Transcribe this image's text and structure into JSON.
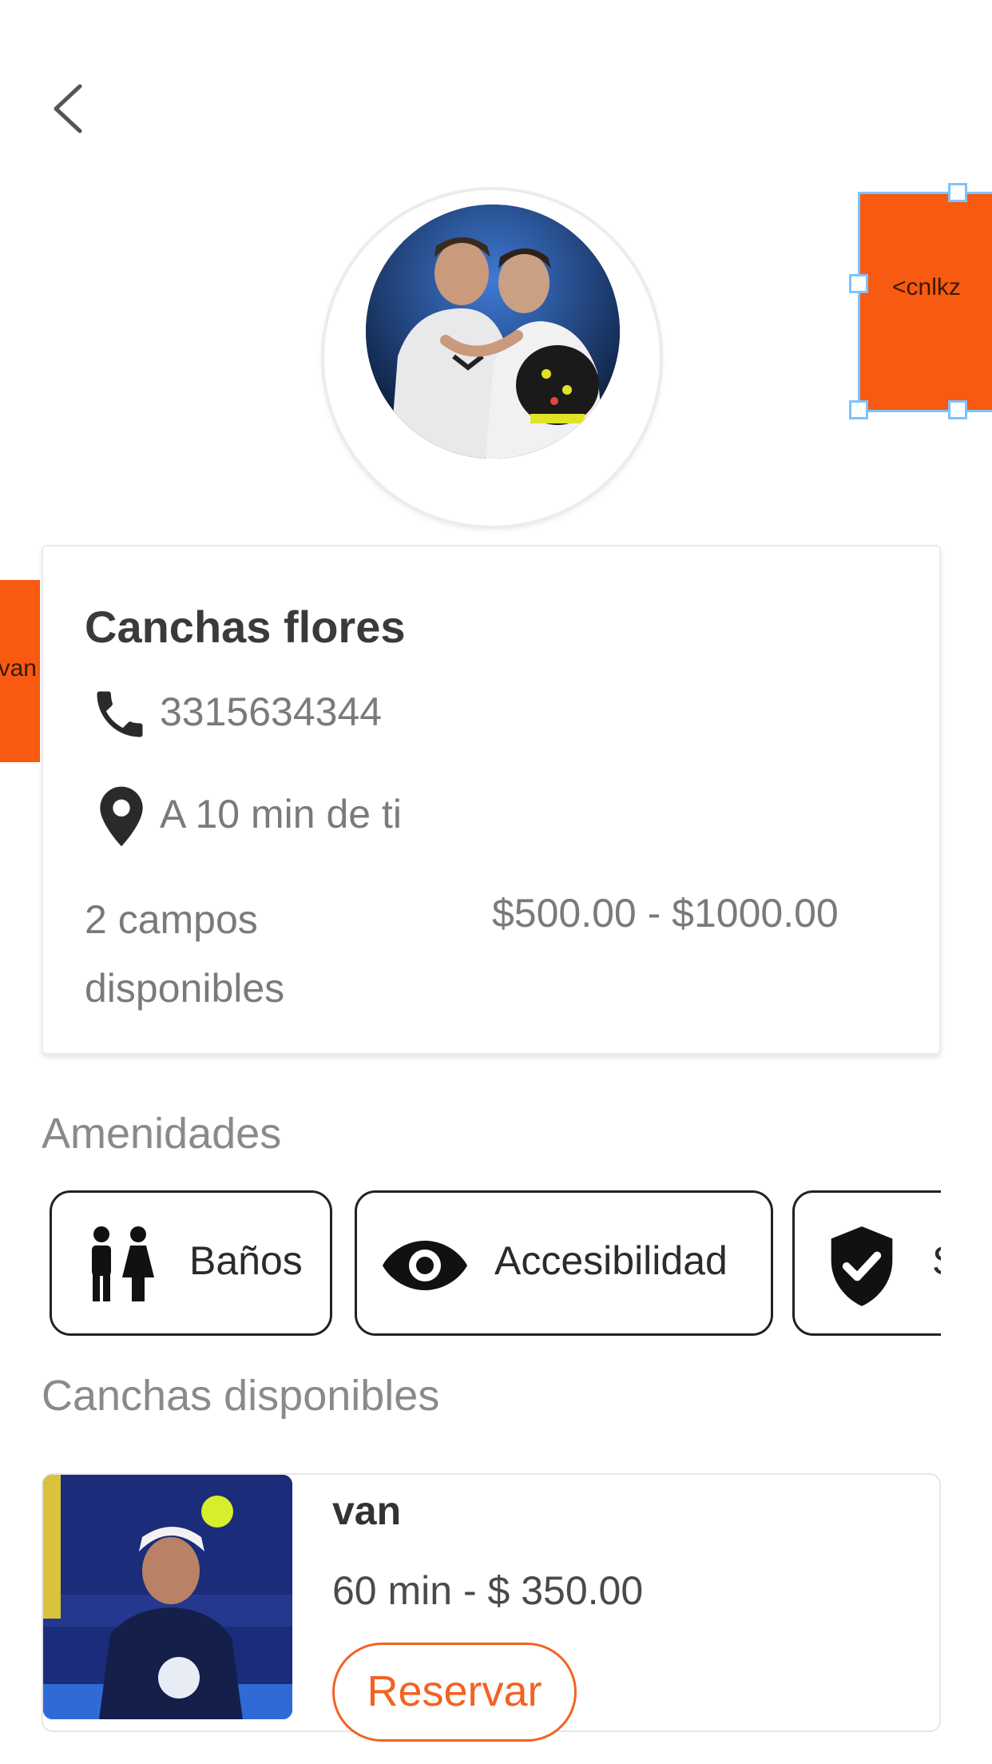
{
  "colors": {
    "accent": "#f26322",
    "sticker": "#f75a10",
    "selection": "#7cc4ff",
    "muted_text": "#7a7a7a",
    "title_text": "#3a3a3a"
  },
  "header": {
    "back_icon": "chevron-left-icon"
  },
  "overlays": {
    "right_sticker_text": "<cnlkz",
    "left_sticker_text": "van"
  },
  "venue": {
    "name": "Canchas flores",
    "phone_icon": "phone-icon",
    "phone": "3315634344",
    "location_icon": "location-pin-icon",
    "distance": "A 10 min de ti",
    "fields": "2 campos disponibles",
    "price_range": "$500.00 - $1000.00"
  },
  "amenities": {
    "title": "Amenidades",
    "items": [
      {
        "icon": "restroom-icon",
        "label": "Baños"
      },
      {
        "icon": "eye-icon",
        "label": "Accesibilidad"
      },
      {
        "icon": "shield-check-icon",
        "label": "S"
      }
    ]
  },
  "courts": {
    "title": "Canchas disponibles",
    "items": [
      {
        "name": "van",
        "details": "60 min - $ 350.00",
        "button": "Reservar"
      }
    ]
  }
}
